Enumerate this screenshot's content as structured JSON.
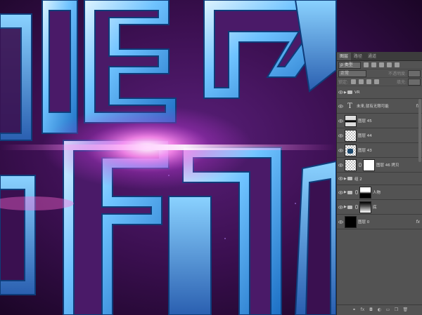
{
  "panel": {
    "tabs": [
      "图层",
      "路径",
      "通道"
    ],
    "filter_label": "ρ 类型",
    "blend_mode": "正常",
    "opacity_label": "不透明度:",
    "lock_label": "锁定:",
    "fill_label": "填充:"
  },
  "layers": [
    {
      "name": "VR",
      "type": "group",
      "fx": ""
    },
    {
      "name": "未来,就有无限可能",
      "type": "text",
      "fx": "fx"
    },
    {
      "name": "图层 45",
      "type": "pixel",
      "fx": ""
    },
    {
      "name": "图层 44",
      "type": "pixel",
      "fx": ""
    },
    {
      "name": "图层 43",
      "type": "pixel",
      "fx": ""
    },
    {
      "name": "图层 46 拷贝",
      "type": "masked",
      "fx": ""
    },
    {
      "name": "组 2",
      "type": "group",
      "fx": ""
    },
    {
      "name": "人物",
      "type": "group-masked",
      "fx": ""
    },
    {
      "name": "底",
      "type": "group-masked",
      "fx": ""
    },
    {
      "name": "图层 0",
      "type": "pixel",
      "fx": "fx"
    }
  ],
  "footer_icons": [
    "link-icon",
    "fx-icon",
    "mask-icon",
    "adjustment-icon",
    "folder-icon",
    "new-layer-icon",
    "trash-icon"
  ]
}
